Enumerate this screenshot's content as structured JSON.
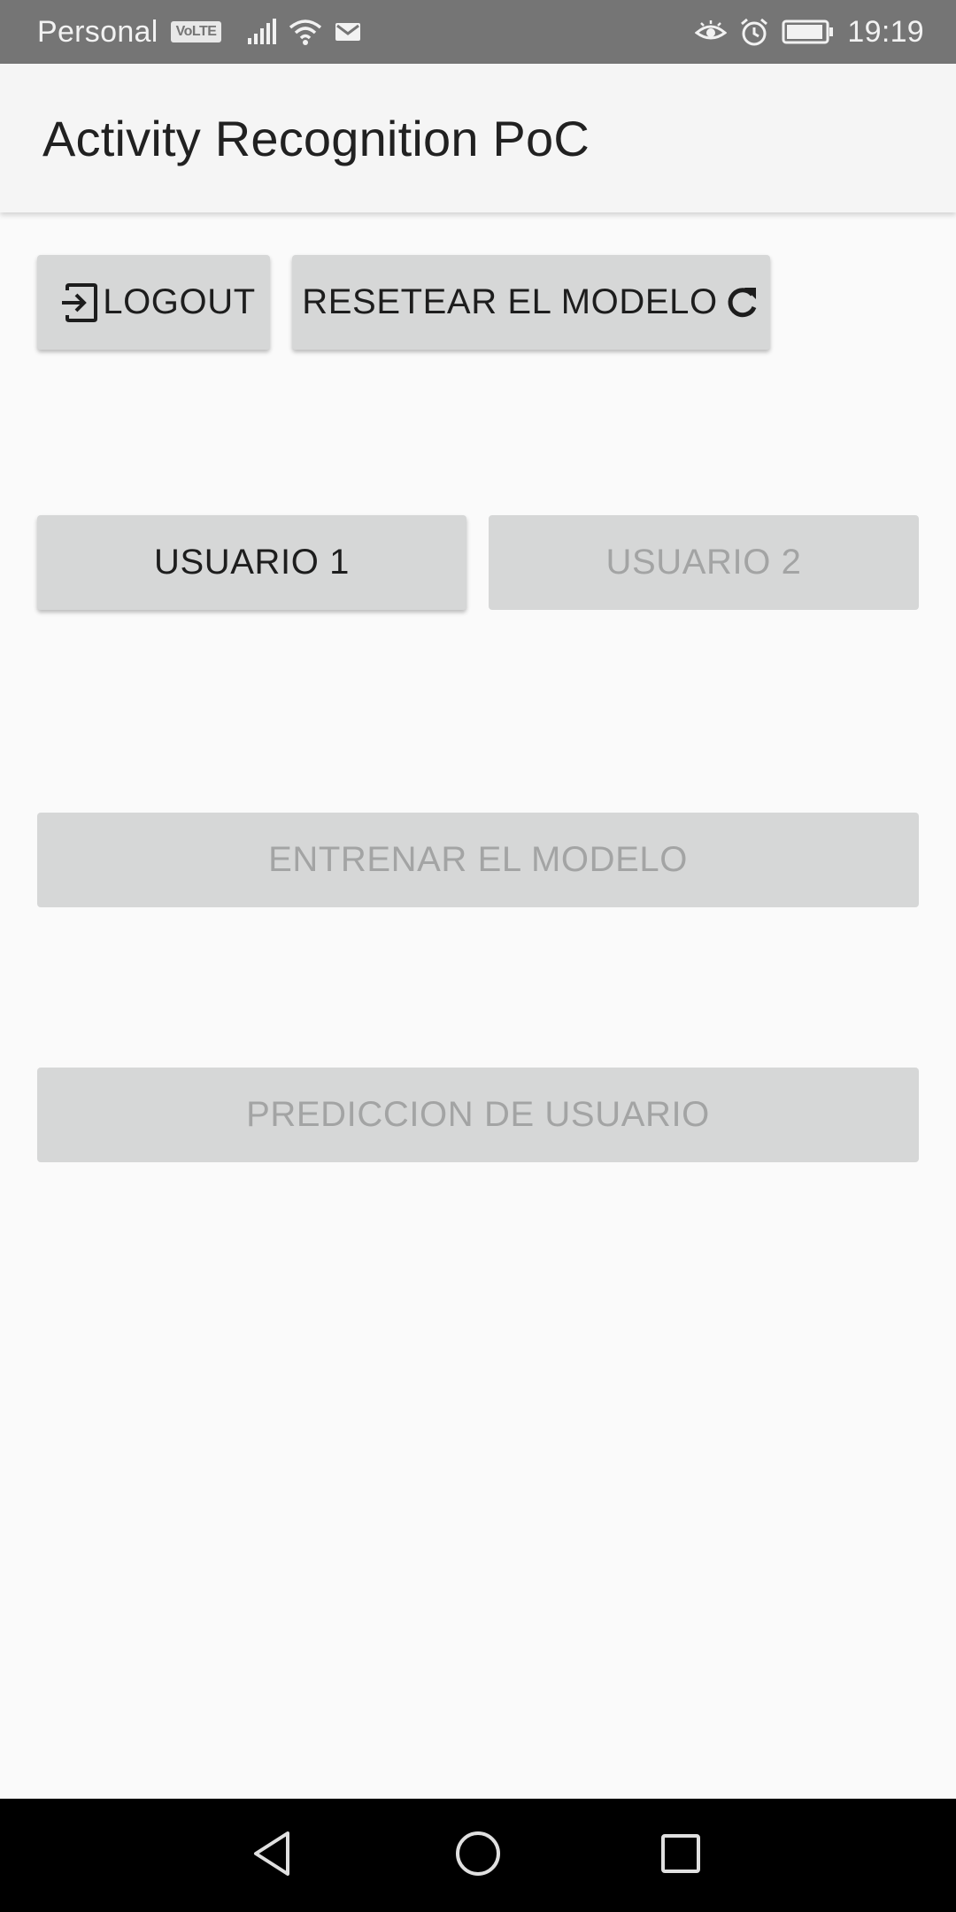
{
  "status_bar": {
    "carrier": "Personal",
    "volte_badge": "VoLTE",
    "time": "19:19",
    "icons": [
      "volte-icon",
      "signal-icon",
      "wifi-icon",
      "mail-icon",
      "eye-comfort-icon",
      "alarm-icon",
      "battery-icon"
    ]
  },
  "app_bar": {
    "title": "Activity Recognition PoC"
  },
  "buttons": {
    "logout": {
      "label": "LOGOUT",
      "icon": "logout-icon",
      "enabled": true
    },
    "reset": {
      "label": "RESETEAR EL MODELO",
      "icon": "refresh-icon",
      "enabled": true
    },
    "user1": {
      "label": "USUARIO 1",
      "enabled": true
    },
    "user2": {
      "label": "USUARIO 2",
      "enabled": false
    },
    "train": {
      "label": "ENTRENAR EL MODELO",
      "enabled": false
    },
    "predict": {
      "label": "PREDICCION DE USUARIO",
      "enabled": false
    }
  },
  "nav_bar": {
    "icons": [
      "back-icon",
      "home-icon",
      "recent-apps-icon"
    ]
  },
  "colors": {
    "status_bar_bg": "#757575",
    "app_bar_bg": "#f5f5f5",
    "button_bg": "#d6d7d7",
    "enabled_text": "#1d1d1d",
    "disabled_text": "#a3a4a4"
  }
}
